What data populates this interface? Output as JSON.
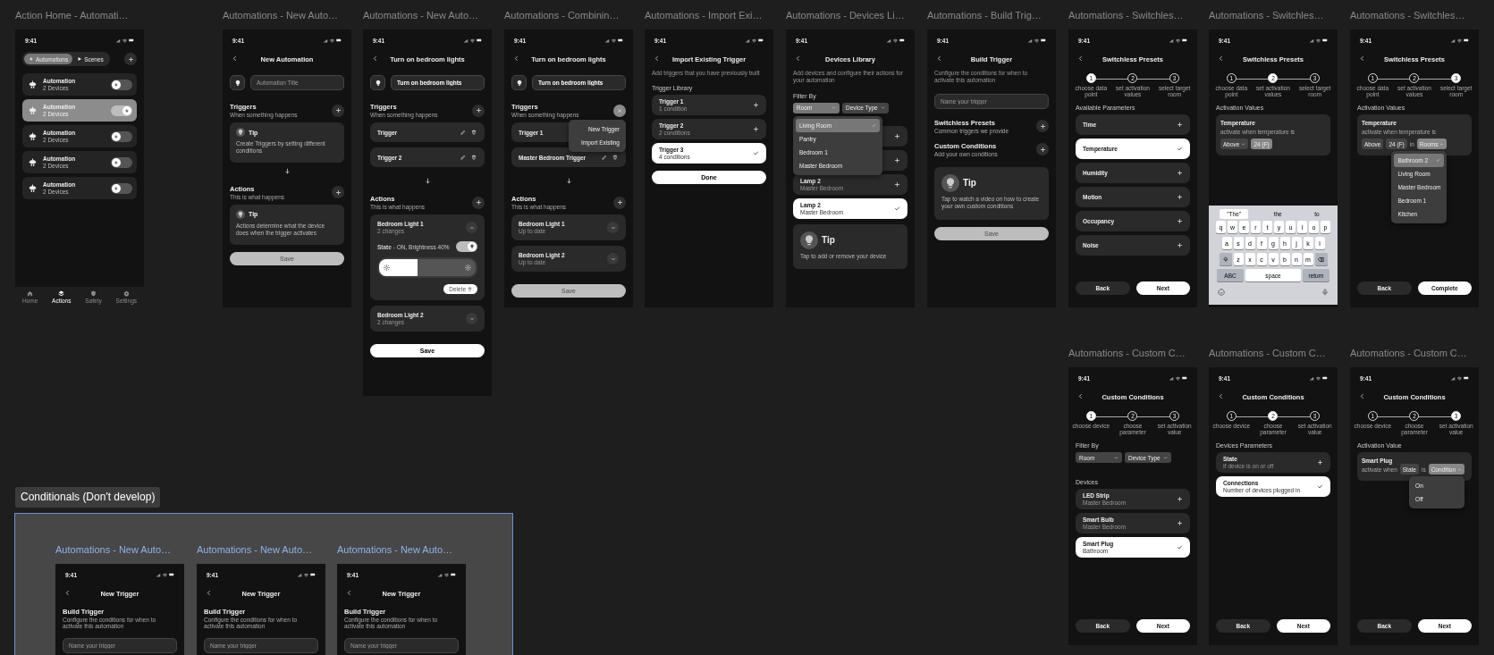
{
  "frames": [
    {
      "title": "Action Home - Automati…",
      "time": "9:41",
      "blocks": [
        {
          "kind": "segmented",
          "tabs": [
            {
              "label": "Automations",
              "selected": true
            },
            {
              "label": "Scenes",
              "selected": false
            }
          ]
        },
        {
          "kind": "automation",
          "title": "Automation",
          "subtitle": "2 Devices",
          "on": false,
          "selected": false
        },
        {
          "kind": "automation",
          "title": "Automation",
          "subtitle": "2 Devices",
          "on": true,
          "selected": true
        },
        {
          "kind": "automation",
          "title": "Automation",
          "subtitle": "2 Devices",
          "on": false,
          "selected": false
        },
        {
          "kind": "automation",
          "title": "Automation",
          "subtitle": "2 Devices",
          "on": false,
          "selected": false
        },
        {
          "kind": "automation",
          "title": "Automation",
          "subtitle": "2 Devices",
          "on": false,
          "selected": false
        },
        {
          "kind": "tab_bar",
          "items": [
            {
              "label": "Home",
              "selected": false
            },
            {
              "label": "Actions",
              "selected": true
            },
            {
              "label": "Safety",
              "selected": false
            },
            {
              "label": "Settings",
              "selected": false
            }
          ]
        }
      ]
    },
    {
      "title": "Automations - New Auto…",
      "time": "9:41",
      "blocks": [
        {
          "kind": "nav",
          "title": "New Automation"
        },
        {
          "kind": "title_field",
          "placeholder": "Automation Title"
        },
        {
          "kind": "section",
          "title": "Triggers",
          "subtitle": "When something happens",
          "add_button": true
        },
        {
          "kind": "tip",
          "title": "Tip",
          "text": "Create Triggers by setting different conditions",
          "large": false
        },
        {
          "kind": "arrow"
        },
        {
          "kind": "section",
          "title": "Actions",
          "subtitle": "This is what happens",
          "add_button": true
        },
        {
          "kind": "tip",
          "title": "Tip",
          "text": "Actions determine what the device does when the trigger activates",
          "large": false
        },
        {
          "kind": "button",
          "label": "Save",
          "disabled": true
        }
      ]
    },
    {
      "title": "Automations - New Auto…",
      "time": "9:41",
      "blocks": [
        {
          "kind": "nav",
          "title": "Turn on bedroom lights"
        },
        {
          "kind": "title_field",
          "value": "Turn on bedroom lights"
        },
        {
          "kind": "section",
          "title": "Triggers",
          "subtitle": "When something happens",
          "add_button": true
        },
        {
          "kind": "trigger",
          "title": "Trigger",
          "editable": true
        },
        {
          "kind": "trigger",
          "title": "Trigger 2",
          "editable": true
        },
        {
          "kind": "arrow"
        },
        {
          "kind": "section",
          "title": "Actions",
          "subtitle": "This is what happens",
          "add_button": true
        },
        {
          "kind": "action_card",
          "title": "Bedroom Light 1",
          "subtitle": "2 changes",
          "expanded": true,
          "state": "**State** - ON, Brightness 40%",
          "state_on": true,
          "level": 0.4,
          "delete_label": "Delete"
        },
        {
          "kind": "action_card",
          "title": "Bedroom Light 2",
          "subtitle": "2 changes",
          "expanded": false
        },
        {
          "kind": "button",
          "label": "Save",
          "disabled": false
        }
      ]
    },
    {
      "title": "Automations - Combinin…",
      "time": "9:41",
      "blocks": [
        {
          "kind": "nav",
          "title": "Turn on bedroom lights"
        },
        {
          "kind": "title_field",
          "value": "Turn on bedroom lights"
        },
        {
          "kind": "section",
          "title": "Triggers",
          "subtitle": "When something happens",
          "close_button": true,
          "menu": [
            {
              "label": "New Trigger"
            },
            {
              "label": "Import Existing"
            }
          ]
        },
        {
          "kind": "trigger",
          "title": "Trigger 1"
        },
        {
          "kind": "trigger",
          "title": "Master Bedroom Trigger",
          "editable": true
        },
        {
          "kind": "arrow"
        },
        {
          "kind": "section",
          "title": "Actions",
          "subtitle": "This is what happens",
          "add_button": true
        },
        {
          "kind": "action_card",
          "title": "Bedroom Light 1",
          "subtitle": "Up to date",
          "expanded": false
        },
        {
          "kind": "action_card",
          "title": "Bedroom Light 2",
          "subtitle": "Up to date",
          "expanded": false
        },
        {
          "kind": "button",
          "label": "Save",
          "disabled": true
        }
      ]
    },
    {
      "title": "Automations - Import Exi…",
      "time": "9:41",
      "blocks": [
        {
          "kind": "nav",
          "title": "Import Existing Trigger"
        },
        {
          "kind": "description",
          "text": "Add triggers that you have previously built"
        },
        {
          "kind": "heading",
          "text": "Trigger Library"
        },
        {
          "kind": "list",
          "items": [
            {
              "title": "Trigger 1",
              "subtitle": "1 condition",
              "selected": false
            },
            {
              "title": "Trigger 2",
              "subtitle": "2 conditions",
              "selected": false
            },
            {
              "title": "Trigger 3",
              "subtitle": "4 conditions",
              "selected": true
            }
          ]
        },
        {
          "kind": "button",
          "label": "Done",
          "disabled": false
        }
      ]
    },
    {
      "title": "Automations - Devices Li…",
      "time": "9:41",
      "blocks": [
        {
          "kind": "nav",
          "title": "Devices Library"
        },
        {
          "kind": "description",
          "text": "Add devices and configure their actions for your automation"
        },
        {
          "kind": "heading",
          "text": "Filter By"
        },
        {
          "kind": "filter",
          "dropdowns": [
            {
              "label": "Room",
              "expanded": true,
              "menu": [
                {
                  "label": "Living Room",
                  "selected": true
                },
                {
                  "label": "Pantry",
                  "selected": false
                },
                {
                  "label": "Bedroom 1",
                  "selected": false
                },
                {
                  "label": "Master Bedroom",
                  "selected": false
                }
              ]
            },
            {
              "label": "Device Type",
              "expanded": false
            }
          ]
        },
        {
          "kind": "list",
          "items": [
            {
              "selected": false
            },
            {
              "selected": false
            },
            {
              "title": "Lamp 2",
              "subtitle": "Master Bedroom",
              "selected": false
            },
            {
              "title": "Lamp 2",
              "subtitle": "Master Bedroom",
              "selected": true
            }
          ]
        },
        {
          "kind": "tip",
          "title": "Tip",
          "text": "Tap to add or remove your device",
          "large": true
        }
      ]
    },
    {
      "title": "Automations - Build Trig…",
      "time": "9:41",
      "blocks": [
        {
          "kind": "nav",
          "title": "Build Trigger"
        },
        {
          "kind": "description",
          "text": "Configure the conditions for when to activate this automation"
        },
        {
          "kind": "name_field",
          "placeholder": "Name your trigger"
        },
        {
          "kind": "section",
          "title": "Switchless Presets",
          "subtitle": "Common triggers we provide",
          "add_button": true
        },
        {
          "kind": "section",
          "title": "Custom Conditions",
          "subtitle": "Add your own conditions",
          "add_button": true
        },
        {
          "kind": "tip",
          "title": "Tip",
          "text": "Tap to watch a video on how to create your own custom conditions",
          "large": true
        },
        {
          "kind": "button",
          "label": "Save",
          "disabled": true
        }
      ]
    },
    {
      "title": "Automations - Switchles…",
      "time": "9:41",
      "blocks": [
        {
          "kind": "nav",
          "title": "Switchless Presets"
        },
        {
          "kind": "stepper",
          "steps": [
            {
              "number": "1",
              "label": "choose data point",
              "selected": true
            },
            {
              "number": "2",
              "label": "set activation values",
              "selected": false
            },
            {
              "number": "3",
              "label": "select target room",
              "selected": false
            }
          ]
        },
        {
          "kind": "heading",
          "text": "Available Parameters"
        },
        {
          "kind": "list",
          "items": [
            {
              "title": "Time",
              "selected": false
            },
            {
              "title": "Temperature",
              "selected": true
            },
            {
              "title": "Humidity",
              "selected": false
            },
            {
              "title": "Motion",
              "selected": false
            },
            {
              "title": "Occupancy",
              "selected": false
            },
            {
              "title": "Noise",
              "selected": false
            }
          ]
        },
        {
          "kind": "footer",
          "buttons": [
            {
              "label": "Back",
              "primary": false
            },
            {
              "label": "Next",
              "primary": true
            }
          ]
        }
      ]
    },
    {
      "title": "Automations - Switchles…",
      "time": "9:41",
      "blocks": [
        {
          "kind": "nav",
          "title": "Switchless Presets"
        },
        {
          "kind": "stepper",
          "steps": [
            {
              "number": "1",
              "label": "choose data point",
              "selected": false
            },
            {
              "number": "2",
              "label": "set activation values",
              "selected": true
            },
            {
              "number": "3",
              "label": "select target room",
              "selected": false
            }
          ]
        },
        {
          "kind": "heading",
          "text": "Activation Values"
        },
        {
          "kind": "condition",
          "title": "Temperature",
          "text": "activate when temperature is",
          "controls": [
            {
              "kind": "dropdown",
              "label": "Above",
              "expanded": false
            },
            {
              "kind": "value",
              "label": "24 (F)",
              "focused": true
            }
          ]
        },
        {
          "kind": "keyboard",
          "suggestions": [
            {
              "label": "\"The\"",
              "selected": true
            },
            {
              "label": "the",
              "selected": false
            },
            {
              "label": "to",
              "selected": false
            }
          ],
          "rows": [
            [
              "q",
              "w",
              "e",
              "r",
              "t",
              "y",
              "u",
              "i",
              "o",
              "p"
            ],
            [
              "a",
              "s",
              "d",
              "f",
              "g",
              "h",
              "j",
              "k",
              "l"
            ],
            [
              "z",
              "x",
              "c",
              "v",
              "b",
              "n",
              "m"
            ]
          ],
          "bottom": [
            "ABC",
            "space",
            "return"
          ]
        }
      ]
    },
    {
      "title": "Automations - Switchles…",
      "time": "9:41",
      "blocks": [
        {
          "kind": "nav",
          "title": "Switchless Presets"
        },
        {
          "kind": "stepper",
          "steps": [
            {
              "number": "1",
              "label": "choose data point",
              "selected": false
            },
            {
              "number": "2",
              "label": "set activation values",
              "selected": false
            },
            {
              "number": "3",
              "label": "select target room",
              "selected": true
            }
          ]
        },
        {
          "kind": "heading",
          "text": "Activation Values"
        },
        {
          "kind": "condition",
          "title": "Temperature",
          "text": "activate when temperature is",
          "controls": [
            {
              "kind": "value",
              "label": "Above",
              "focused": false
            },
            {
              "kind": "value",
              "label": "24 (F)",
              "focused": false
            },
            {
              "kind": "text",
              "label": "in"
            },
            {
              "kind": "dropdown",
              "label": "Rooms",
              "expanded": true,
              "menu": [
                {
                  "label": "Bathroom 2",
                  "selected": true
                },
                {
                  "label": "Living Room",
                  "selected": false
                },
                {
                  "label": "Master Bedroom",
                  "selected": false
                },
                {
                  "label": "Bedroom 1",
                  "selected": false
                },
                {
                  "label": "Kitchen",
                  "selected": false
                }
              ]
            }
          ]
        },
        {
          "kind": "footer",
          "buttons": [
            {
              "label": "Back",
              "primary": false
            },
            {
              "label": "Complete",
              "primary": true
            }
          ]
        }
      ]
    },
    {
      "title": "Automations - Custom C…",
      "time": "9:41",
      "blocks": [
        {
          "kind": "nav",
          "title": "Custom Conditions"
        },
        {
          "kind": "stepper",
          "steps": [
            {
              "number": "1",
              "label": "choose device",
              "selected": true
            },
            {
              "number": "2",
              "label": "choose parameter",
              "selected": false
            },
            {
              "number": "3",
              "label": "set activation value",
              "selected": false
            }
          ]
        },
        {
          "kind": "heading",
          "text": "Filter By"
        },
        {
          "kind": "filter",
          "dropdowns": [
            {
              "label": "Room",
              "expanded": false
            },
            {
              "label": "Device Type",
              "expanded": false
            }
          ]
        },
        {
          "kind": "heading",
          "text": "Devices"
        },
        {
          "kind": "list",
          "items": [
            {
              "title": "LED Strip",
              "subtitle": "Master Bedroom",
              "selected": false
            },
            {
              "title": "Smart Bulb",
              "subtitle": "Master Bedroom",
              "selected": false
            },
            {
              "title": "Smart Plug",
              "subtitle": "Bathroom",
              "selected": true
            }
          ]
        },
        {
          "kind": "footer",
          "buttons": [
            {
              "label": "Back",
              "primary": false
            },
            {
              "label": "Next",
              "primary": true
            }
          ]
        }
      ]
    },
    {
      "title": "Automations - Custom C…",
      "time": "9:41",
      "blocks": [
        {
          "kind": "nav",
          "title": "Custom Conditions"
        },
        {
          "kind": "stepper",
          "steps": [
            {
              "number": "1",
              "label": "choose device",
              "selected": false
            },
            {
              "number": "2",
              "label": "choose parameter",
              "selected": true
            },
            {
              "number": "3",
              "label": "set activation value",
              "selected": false
            }
          ]
        },
        {
          "kind": "heading",
          "text": "Devices Parameters"
        },
        {
          "kind": "list",
          "items": [
            {
              "title": "State",
              "subtitle": "If device is on or off",
              "selected": false
            },
            {
              "title": "Connections",
              "subtitle": "Number of devices plugged in",
              "selected": true
            }
          ]
        },
        {
          "kind": "footer",
          "buttons": [
            {
              "label": "Back",
              "primary": false
            },
            {
              "label": "Next",
              "primary": true
            }
          ]
        }
      ]
    },
    {
      "title": "Automations - Custom C…",
      "time": "9:41",
      "blocks": [
        {
          "kind": "nav",
          "title": "Custom Conditions"
        },
        {
          "kind": "stepper",
          "steps": [
            {
              "number": "1",
              "label": "choose device",
              "selected": false
            },
            {
              "number": "2",
              "label": "choose parameter",
              "selected": false
            },
            {
              "number": "3",
              "label": "set activation value",
              "selected": true
            }
          ]
        },
        {
          "kind": "heading",
          "text": "Activation Value"
        },
        {
          "kind": "condition",
          "title": "Smart Plug",
          "controls": [
            {
              "kind": "text",
              "label": "activate when"
            },
            {
              "kind": "value",
              "label": "State",
              "focused": false
            },
            {
              "kind": "text",
              "label": "is"
            },
            {
              "kind": "dropdown",
              "label": "Condition",
              "expanded": true,
              "menu": [
                {
                  "label": "On"
                },
                {
                  "label": "Off"
                }
              ]
            }
          ]
        },
        {
          "kind": "footer",
          "buttons": [
            {
              "label": "Back",
              "primary": false
            },
            {
              "label": "Next",
              "primary": true
            }
          ]
        }
      ]
    }
  ],
  "conditionals": {
    "label": "Conditionals (Don't develop)",
    "frames": [
      {
        "title": "Automations - New Auto…",
        "time": "9:41",
        "blocks": [
          {
            "kind": "nav",
            "title": "New Trigger"
          },
          {
            "kind": "section",
            "title": "Build Trigger",
            "subtitle": "Configure the conditions for when to activate this automation"
          },
          {
            "kind": "name_field",
            "placeholder": "Name your trigger"
          }
        ]
      },
      {
        "title": "Automations - New Auto…",
        "time": "9:41",
        "blocks": [
          {
            "kind": "nav",
            "title": "New Trigger"
          },
          {
            "kind": "section",
            "title": "Build Trigger",
            "subtitle": "Configure the conditions for when to activate this automation"
          },
          {
            "kind": "name_field",
            "placeholder": "Name your trigger"
          }
        ]
      },
      {
        "title": "Automations - New Auto…",
        "time": "9:41",
        "blocks": [
          {
            "kind": "nav",
            "title": "New Trigger"
          },
          {
            "kind": "section",
            "title": "Build Trigger",
            "subtitle": "Configure the conditions for when to activate this automation"
          },
          {
            "kind": "name_field",
            "placeholder": "Name your trigger"
          }
        ]
      }
    ]
  }
}
